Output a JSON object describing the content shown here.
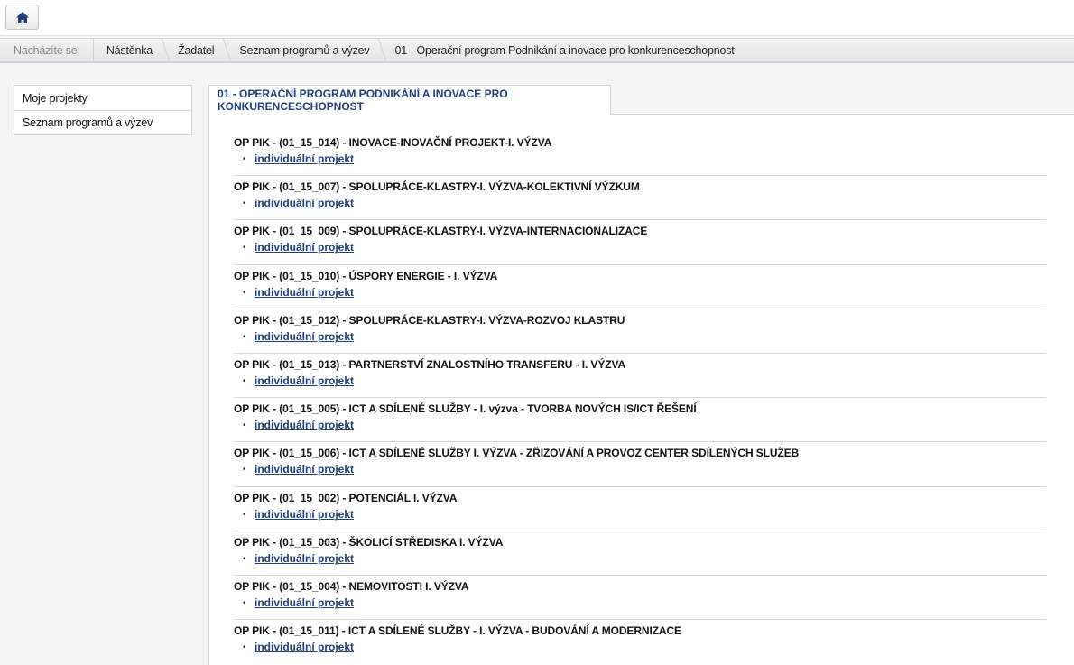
{
  "header": {
    "home_icon": "home-icon"
  },
  "breadcrumb": {
    "prefix": "Nacházíte se:",
    "items": [
      "Nástěnka",
      "Žadatel",
      "Seznam programů a výzev",
      "01 - Operační program Podnikání a inovace pro konkurenceschopnost"
    ]
  },
  "sidebar": {
    "items": [
      {
        "label": "Moje projekty"
      },
      {
        "label": "Seznam programů a výzev"
      }
    ]
  },
  "main": {
    "tab_title": "01 - OPERAČNÍ PROGRAM PODNIKÁNÍ A INOVACE PRO KONKURENCESCHOPNOST",
    "entries": [
      {
        "title": "OP PIK - (01_15_014) - INOVACE-INOVAČNÍ PROJEKT-I. VÝZVA",
        "link": "individuální projekt"
      },
      {
        "title": "OP PIK - (01_15_007) - SPOLUPRÁCE-KLASTRY-I. VÝZVA-KOLEKTIVNÍ VÝZKUM",
        "link": "individuální projekt"
      },
      {
        "title": "OP PIK - (01_15_009) - SPOLUPRÁCE-KLASTRY-I. VÝZVA-INTERNACIONALIZACE",
        "link": "individuální projekt"
      },
      {
        "title": "OP PIK - (01_15_010) - ÚSPORY ENERGIE - I. VÝZVA",
        "link": "individuální projekt"
      },
      {
        "title": "OP PIK - (01_15_012) - SPOLUPRÁCE-KLASTRY-I. VÝZVA-ROZVOJ KLASTRU",
        "link": "individuální projekt"
      },
      {
        "title": "OP PIK - (01_15_013) - PARTNERSTVÍ ZNALOSTNÍHO TRANSFERU - I. VÝZVA",
        "link": "individuální projekt"
      },
      {
        "title": "OP PIK - (01_15_005) - ICT A SDÍLENÉ SLUŽBY - I. výzva - TVORBA NOVÝCH IS/ICT ŘEŠENÍ",
        "link": "individuální projekt"
      },
      {
        "title": "OP PIK - (01_15_006) - ICT A SDÍLENÉ SLUŽBY I. VÝZVA - ZŘIZOVÁNÍ A PROVOZ CENTER SDÍLENÝCH SLUŽEB",
        "link": "individuální projekt"
      },
      {
        "title": "OP PIK - (01_15_002) - POTENCIÁL I. VÝZVA",
        "link": "individuální projekt"
      },
      {
        "title": "OP PIK - (01_15_003) - ŠKOLICÍ STŘEDISKA I. VÝZVA",
        "link": "individuální projekt"
      },
      {
        "title": "OP PIK - (01_15_004) - NEMOVITOSTI I. VÝZVA",
        "link": "individuální projekt"
      },
      {
        "title": "OP PIK - (01_15_011) - ICT A SDÍLENÉ SLUŽBY - I. VÝZVA - BUDOVÁNÍ A MODERNIZACE",
        "link": "individuální projekt"
      }
    ]
  },
  "colors": {
    "accent": "#1f3f7a",
    "home_icon": "#1f3f7a"
  }
}
